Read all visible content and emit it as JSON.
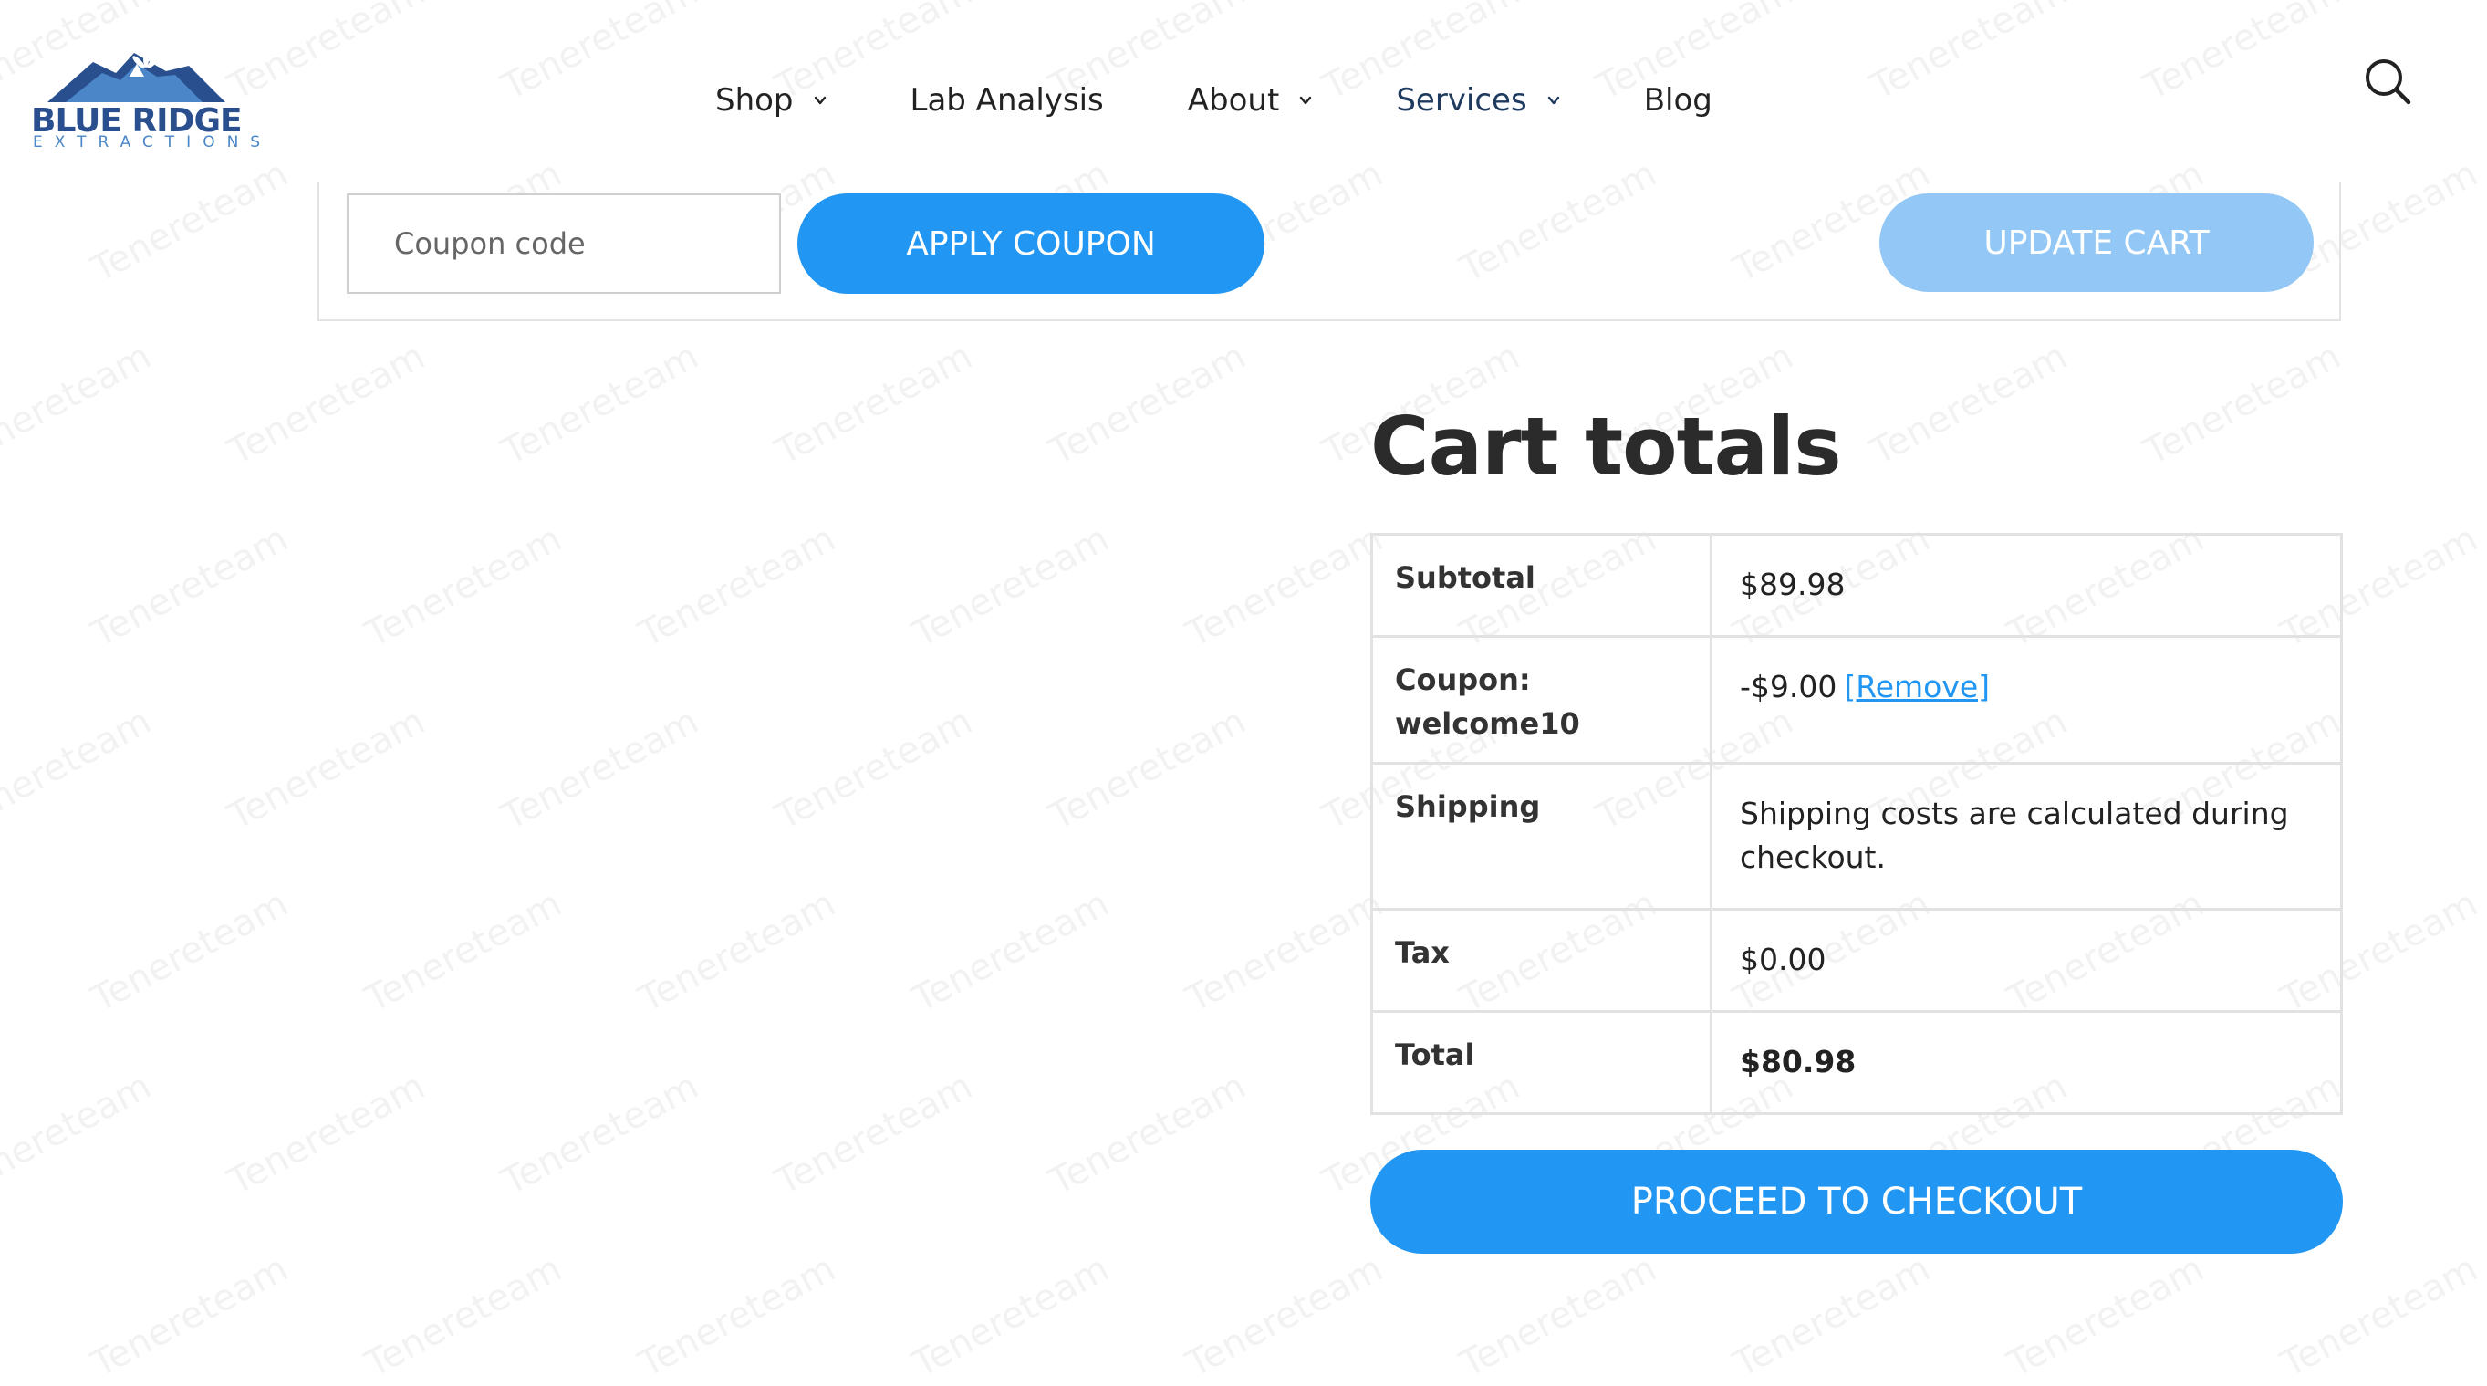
{
  "header": {
    "logo": {
      "brand": "BLUE RIDGE",
      "sub": "EXTRACTIONS",
      "icon": "mountain-leaf-logo"
    },
    "nav": [
      {
        "label": "Shop",
        "has_dropdown": true
      },
      {
        "label": "Lab Analysis",
        "has_dropdown": false
      },
      {
        "label": "About",
        "has_dropdown": true
      },
      {
        "label": "Services",
        "has_dropdown": true,
        "active": true
      },
      {
        "label": "Blog",
        "has_dropdown": false
      }
    ],
    "search_icon": "search-icon"
  },
  "coupon": {
    "placeholder": "Coupon code",
    "apply_label": "APPLY COUPON",
    "update_label": "UPDATE CART"
  },
  "cart_totals": {
    "title": "Cart totals",
    "rows": {
      "subtotal": {
        "label": "Subtotal",
        "value": "$89.98"
      },
      "coupon": {
        "label": "Coupon: welcome10",
        "value": "-$9.00",
        "remove": "[Remove]"
      },
      "shipping": {
        "label": "Shipping",
        "value": "Shipping costs are calculated during checkout."
      },
      "tax": {
        "label": "Tax",
        "value": "$0.00"
      },
      "total": {
        "label": "Total",
        "value": "$80.98"
      }
    },
    "checkout_label": "PROCEED TO CHECKOUT"
  },
  "watermark": "Tenereteam",
  "colors": {
    "accent": "#2196f3",
    "accent_light": "#93c8f6",
    "logo_dark": "#2a4f8f",
    "logo_light": "#4a86c8",
    "text": "#222222"
  }
}
